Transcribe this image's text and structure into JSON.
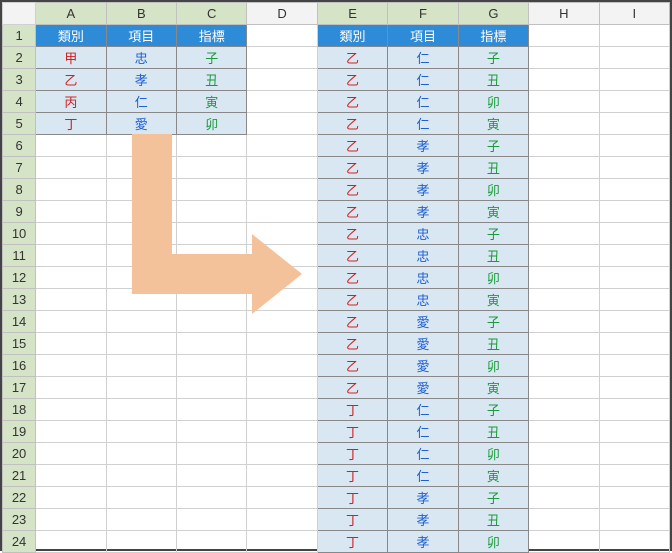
{
  "columns": [
    "A",
    "B",
    "C",
    "D",
    "E",
    "F",
    "G",
    "H",
    "I"
  ],
  "rows": [
    "1",
    "2",
    "3",
    "4",
    "5",
    "6",
    "7",
    "8",
    "9",
    "10",
    "11",
    "12",
    "13",
    "14",
    "15",
    "16",
    "17",
    "18",
    "19",
    "20",
    "21",
    "22",
    "23",
    "24"
  ],
  "selected_cols": [
    "A",
    "B",
    "C",
    "E",
    "F",
    "G"
  ],
  "left": {
    "header": [
      "類別",
      "項目",
      "指標"
    ],
    "rows": [
      [
        "甲",
        "忠",
        "子"
      ],
      [
        "乙",
        "孝",
        "丑"
      ],
      [
        "丙",
        "仁",
        "寅"
      ],
      [
        "丁",
        "愛",
        "卯"
      ]
    ]
  },
  "right": {
    "header": [
      "類別",
      "項目",
      "指標"
    ],
    "rows": [
      [
        "乙",
        "仁",
        "子"
      ],
      [
        "乙",
        "仁",
        "丑"
      ],
      [
        "乙",
        "仁",
        "卯"
      ],
      [
        "乙",
        "仁",
        "寅"
      ],
      [
        "乙",
        "孝",
        "子"
      ],
      [
        "乙",
        "孝",
        "丑"
      ],
      [
        "乙",
        "孝",
        "卯"
      ],
      [
        "乙",
        "孝",
        "寅"
      ],
      [
        "乙",
        "忠",
        "子"
      ],
      [
        "乙",
        "忠",
        "丑"
      ],
      [
        "乙",
        "忠",
        "卯"
      ],
      [
        "乙",
        "忠",
        "寅"
      ],
      [
        "乙",
        "愛",
        "子"
      ],
      [
        "乙",
        "愛",
        "丑"
      ],
      [
        "乙",
        "愛",
        "卯"
      ],
      [
        "乙",
        "愛",
        "寅"
      ],
      [
        "丁",
        "仁",
        "子"
      ],
      [
        "丁",
        "仁",
        "丑"
      ],
      [
        "丁",
        "仁",
        "卯"
      ],
      [
        "丁",
        "仁",
        "寅"
      ],
      [
        "丁",
        "孝",
        "子"
      ],
      [
        "丁",
        "孝",
        "丑"
      ],
      [
        "丁",
        "孝",
        "卯"
      ]
    ]
  }
}
